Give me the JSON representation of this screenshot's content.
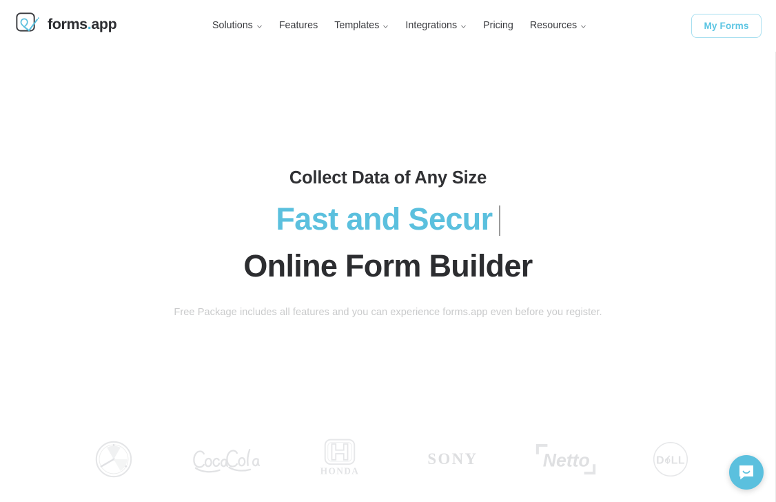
{
  "header": {
    "brand": {
      "name_main": "forms",
      "name_dot": ".",
      "name_suffix": "app",
      "logo_icon": "forms-app-checkmark-logo"
    },
    "nav_items": [
      {
        "label": "Solutions",
        "has_dropdown": true
      },
      {
        "label": "Features",
        "has_dropdown": false
      },
      {
        "label": "Templates",
        "has_dropdown": true
      },
      {
        "label": "Integrations",
        "has_dropdown": true
      },
      {
        "label": "Pricing",
        "has_dropdown": false
      },
      {
        "label": "Resources",
        "has_dropdown": true
      }
    ],
    "cta": {
      "label": "My Forms"
    }
  },
  "hero": {
    "eyebrow": "Collect Data of Any Size",
    "typed_text": "Fast and Secur",
    "title": "Online Form Builder",
    "subtitle": "Free Package includes all features and you can experience forms.app even before you register."
  },
  "brands": [
    {
      "name": "Mercedes-Benz",
      "icon": "mercedes-benz-logo"
    },
    {
      "name": "Coca-Cola",
      "icon": "coca-cola-logo"
    },
    {
      "name": "HONDA",
      "icon": "honda-logo"
    },
    {
      "name": "SONY",
      "icon": "sony-logo"
    },
    {
      "name": "Netto",
      "icon": "netto-logo"
    },
    {
      "name": "DELL",
      "icon": "dell-logo"
    }
  ],
  "chat_widget": {
    "label": "Open Intercom Messenger",
    "icon": "intercom-chat-bubble-icon"
  },
  "colors": {
    "accent": "#5bc0de",
    "accent_border": "#a7dff0",
    "text_dark": "#2c2d30",
    "text_muted": "#c9cacb",
    "background": "#ffffff",
    "brand_logo_gray": "#e2e3e5"
  }
}
